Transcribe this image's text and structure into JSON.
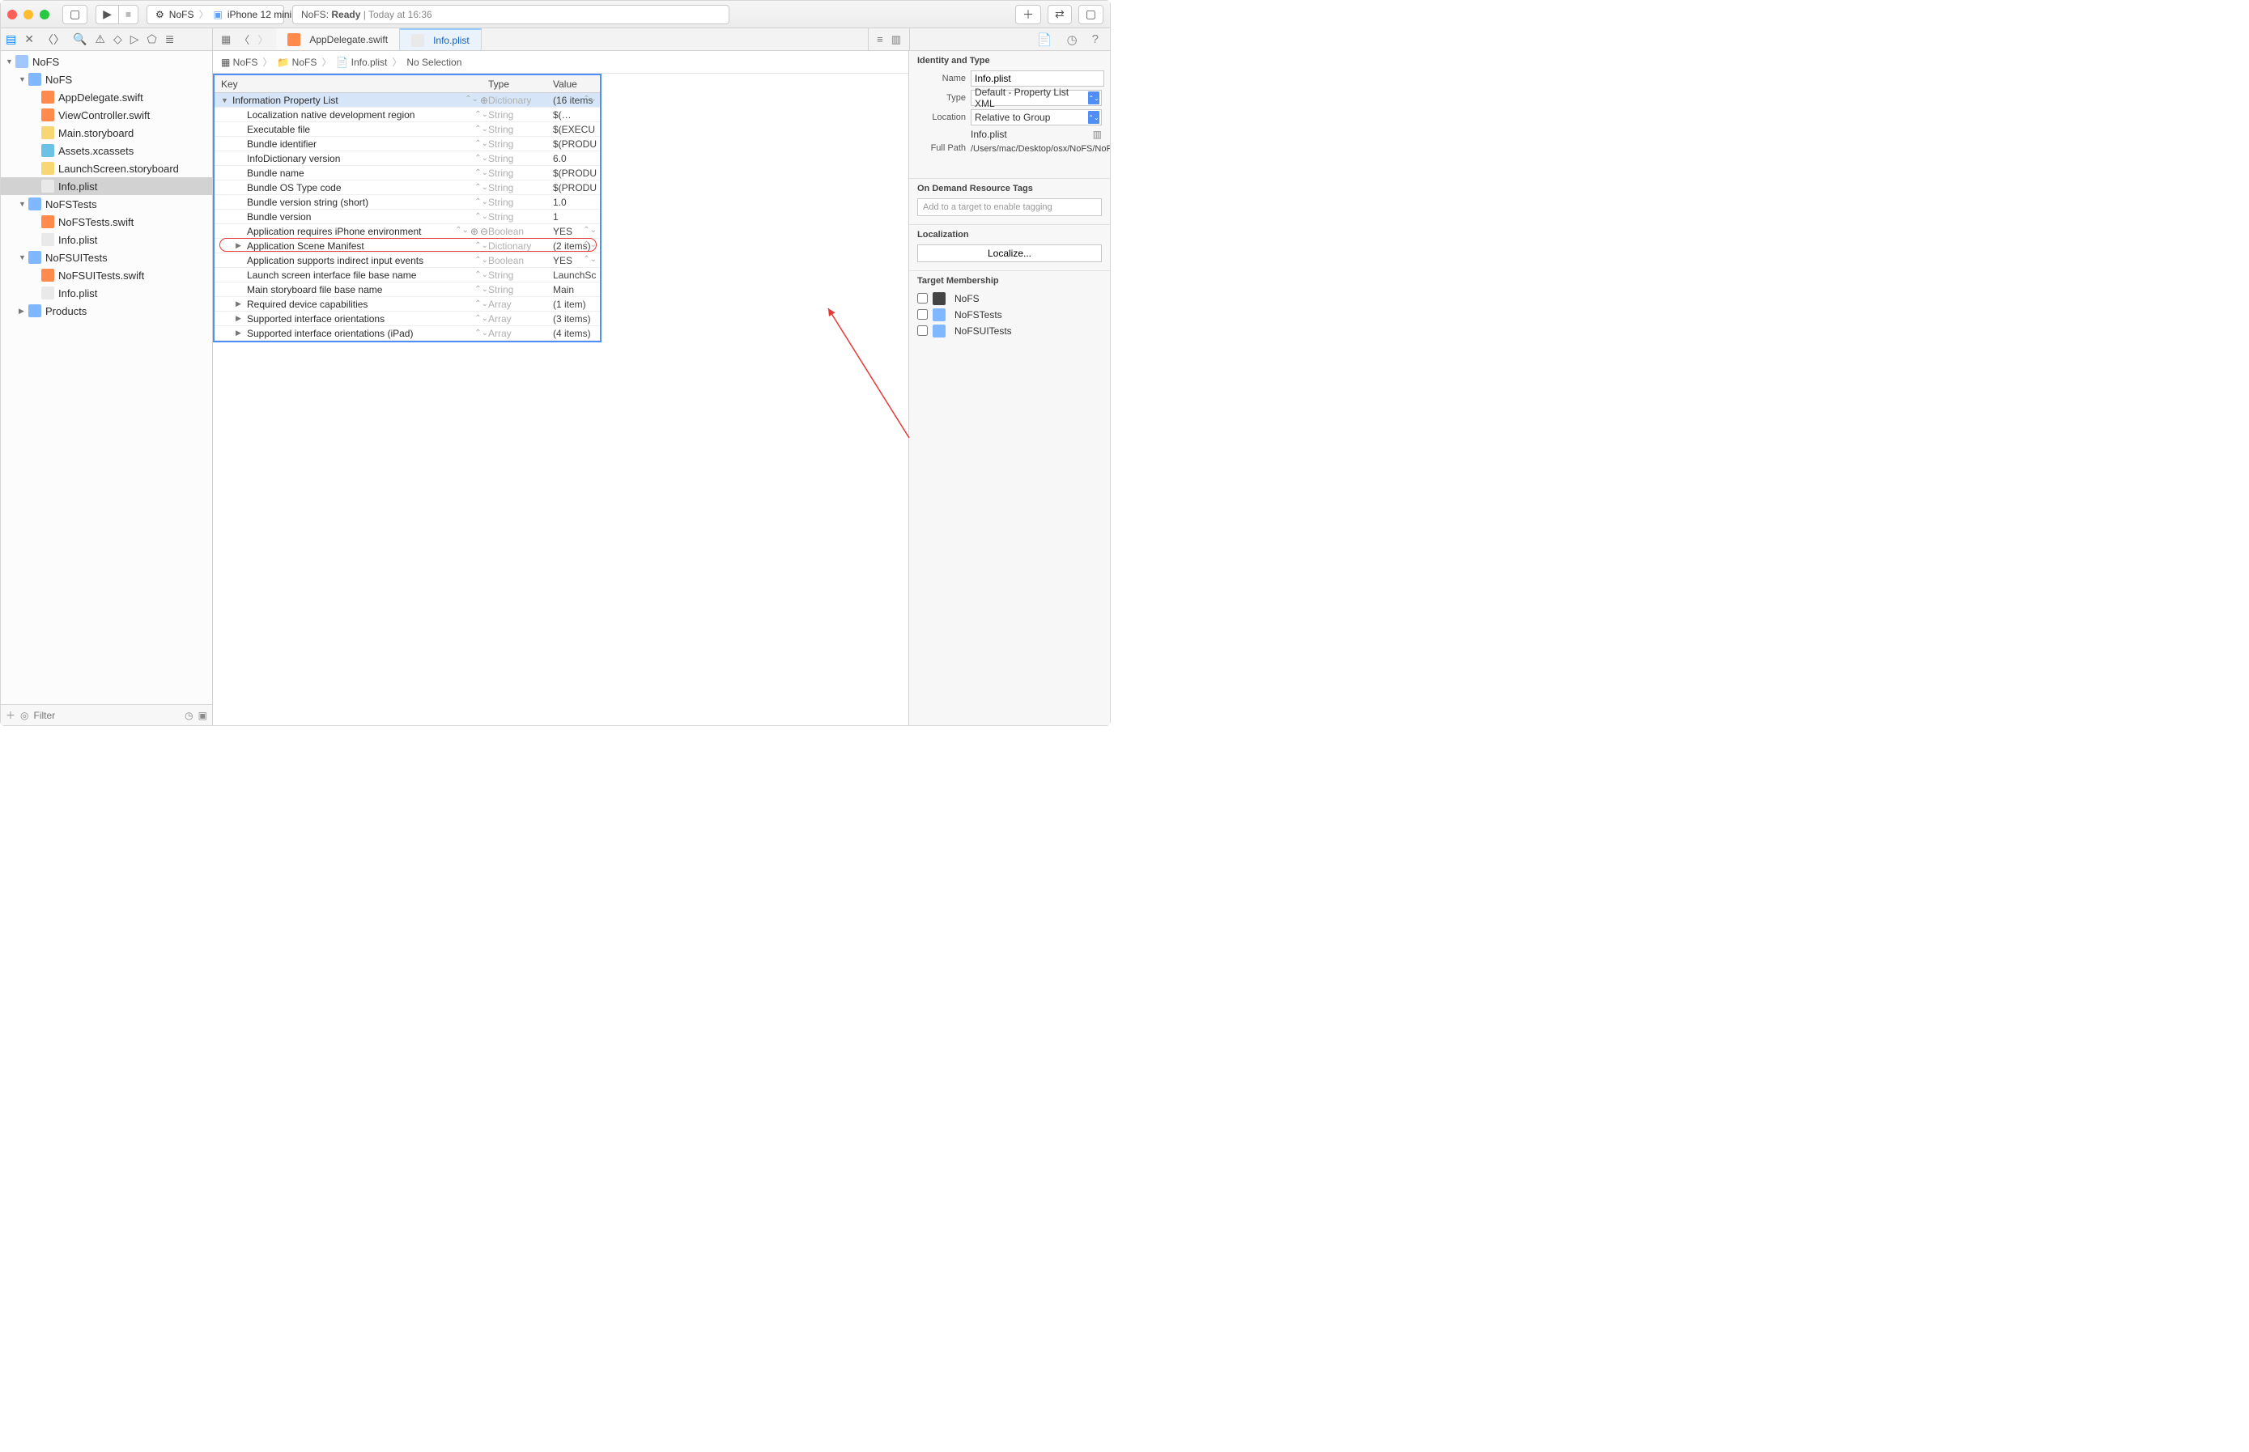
{
  "titlebar": {
    "scheme_app": "NoFS",
    "scheme_device": "iPhone 12 mini",
    "status_project": "NoFS:",
    "status_state": "Ready",
    "status_time": "Today at 16:36"
  },
  "tabs": {
    "items": [
      {
        "label": "AppDelegate.swift",
        "active": false,
        "icon": "swift"
      },
      {
        "label": "Info.plist",
        "active": true,
        "icon": "plist"
      }
    ]
  },
  "navigator": {
    "root": "NoFS",
    "tree": [
      {
        "depth": 0,
        "disclosure": "open",
        "icon": "proj",
        "label": "NoFS"
      },
      {
        "depth": 1,
        "disclosure": "open",
        "icon": "folder",
        "label": "NoFS"
      },
      {
        "depth": 2,
        "disclosure": "none",
        "icon": "swift",
        "label": "AppDelegate.swift"
      },
      {
        "depth": 2,
        "disclosure": "none",
        "icon": "swift",
        "label": "ViewController.swift"
      },
      {
        "depth": 2,
        "disclosure": "none",
        "icon": "sb",
        "label": "Main.storyboard"
      },
      {
        "depth": 2,
        "disclosure": "none",
        "icon": "assets",
        "label": "Assets.xcassets"
      },
      {
        "depth": 2,
        "disclosure": "none",
        "icon": "sb",
        "label": "LaunchScreen.storyboard"
      },
      {
        "depth": 2,
        "disclosure": "none",
        "icon": "plist",
        "label": "Info.plist",
        "selected": true
      },
      {
        "depth": 1,
        "disclosure": "open",
        "icon": "folder",
        "label": "NoFSTests"
      },
      {
        "depth": 2,
        "disclosure": "none",
        "icon": "swift",
        "label": "NoFSTests.swift"
      },
      {
        "depth": 2,
        "disclosure": "none",
        "icon": "plist",
        "label": "Info.plist"
      },
      {
        "depth": 1,
        "disclosure": "open",
        "icon": "folder",
        "label": "NoFSUITests"
      },
      {
        "depth": 2,
        "disclosure": "none",
        "icon": "swift",
        "label": "NoFSUITests.swift"
      },
      {
        "depth": 2,
        "disclosure": "none",
        "icon": "plist",
        "label": "Info.plist"
      },
      {
        "depth": 1,
        "disclosure": "closed",
        "icon": "folder",
        "label": "Products"
      }
    ],
    "filter_placeholder": "Filter"
  },
  "jumpbar": {
    "crumbs": [
      "NoFS",
      "NoFS",
      "Info.plist",
      "No Selection"
    ]
  },
  "plist": {
    "head": {
      "key": "Key",
      "type": "Type",
      "value": "Value"
    },
    "rows": [
      {
        "indent": 0,
        "tri": "open",
        "key": "Information Property List",
        "type": "Dictionary",
        "value": "(16 items",
        "selected": true,
        "rowbtns": "plus"
      },
      {
        "indent": 1,
        "tri": "",
        "key": "Localization native development region",
        "type": "String",
        "value": "$(…"
      },
      {
        "indent": 1,
        "tri": "",
        "key": "Executable file",
        "type": "String",
        "value": "$(EXECU"
      },
      {
        "indent": 1,
        "tri": "",
        "key": "Bundle identifier",
        "type": "String",
        "value": "$(PRODU"
      },
      {
        "indent": 1,
        "tri": "",
        "key": "InfoDictionary version",
        "type": "String",
        "value": "6.0"
      },
      {
        "indent": 1,
        "tri": "",
        "key": "Bundle name",
        "type": "String",
        "value": "$(PRODU"
      },
      {
        "indent": 1,
        "tri": "",
        "key": "Bundle OS Type code",
        "type": "String",
        "value": "$(PRODU"
      },
      {
        "indent": 1,
        "tri": "",
        "key": "Bundle version string (short)",
        "type": "String",
        "value": "1.0"
      },
      {
        "indent": 1,
        "tri": "",
        "key": "Bundle version",
        "type": "String",
        "value": "1"
      },
      {
        "indent": 1,
        "tri": "",
        "key": "Application requires iPhone environment",
        "type": "Boolean",
        "value": "YES",
        "rowbtns": "plusminus"
      },
      {
        "indent": 1,
        "tri": "closed",
        "key": "Application Scene Manifest",
        "type": "Dictionary",
        "value": "(2 items)",
        "circled": true
      },
      {
        "indent": 1,
        "tri": "",
        "key": "Application supports indirect input events",
        "type": "Boolean",
        "value": "YES"
      },
      {
        "indent": 1,
        "tri": "",
        "key": "Launch screen interface file base name",
        "type": "String",
        "value": "LaunchSc"
      },
      {
        "indent": 1,
        "tri": "",
        "key": "Main storyboard file base name",
        "type": "String",
        "value": "Main"
      },
      {
        "indent": 1,
        "tri": "closed",
        "key": "Required device capabilities",
        "type": "Array",
        "value": "(1 item)"
      },
      {
        "indent": 1,
        "tri": "closed",
        "key": "Supported interface orientations",
        "type": "Array",
        "value": "(3 items)"
      },
      {
        "indent": 1,
        "tri": "closed",
        "key": "Supported interface orientations (iPad)",
        "type": "Array",
        "value": "(4 items)"
      }
    ]
  },
  "inspector": {
    "identity_title": "Identity and Type",
    "name_label": "Name",
    "name_value": "Info.plist",
    "type_label": "Type",
    "type_value": "Default - Property List XML",
    "location_label": "Location",
    "location_value": "Relative to Group",
    "location_file": "Info.plist",
    "fullpath_label": "Full Path",
    "fullpath_value": "/Users/mac/Desktop/osx/NoFS/NoFS/Info.plist",
    "tags_title": "On Demand Resource Tags",
    "tags_placeholder": "Add to a target to enable tagging",
    "loc_title": "Localization",
    "loc_button": "Localize...",
    "tm_title": "Target Membership",
    "tm_items": [
      {
        "label": "NoFS",
        "icon": "app"
      },
      {
        "label": "NoFSTests",
        "icon": "folder"
      },
      {
        "label": "NoFSUITests",
        "icon": "folder"
      }
    ]
  }
}
